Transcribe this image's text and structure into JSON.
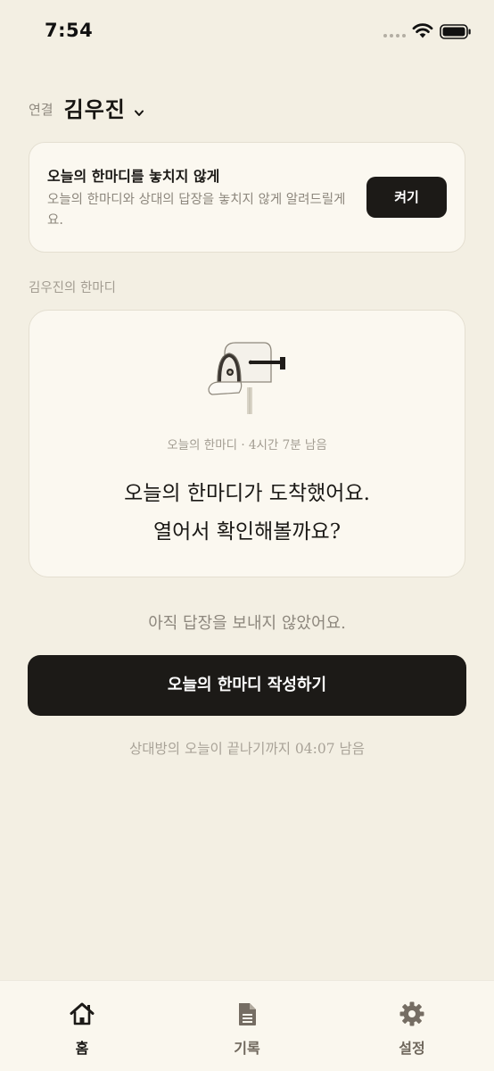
{
  "status_bar": {
    "time": "7:54"
  },
  "connection": {
    "label": "연결",
    "name": "김우진"
  },
  "notification_card": {
    "title": "오늘의 한마디를 놓치지 않게",
    "description": "오늘의 한마디와 상대의 답장을 놓치지 않게 알려드릴게요.",
    "button_label": "켜기"
  },
  "section_label": "김우진의 한마디",
  "message_card": {
    "meta": "오늘의 한마디 · 4시간 7분 남음",
    "line1": "오늘의 한마디가 도착했어요.",
    "line2": "열어서 확인해볼까요?"
  },
  "reply_status": "아직 답장을 보내지 않았어요.",
  "write_button_label": "오늘의 한마디 작성하기",
  "countdown_text": "상대방의 오늘이 끝나기까지 04:07 남음",
  "tabs": [
    {
      "label": "홈",
      "icon": "home-icon",
      "active": true
    },
    {
      "label": "기록",
      "icon": "document-icon",
      "active": false
    },
    {
      "label": "설정",
      "icon": "gear-icon",
      "active": false
    }
  ],
  "colors": {
    "background": "#f3efe3",
    "card": "#fbf8f0",
    "primary_button": "#1c1a17",
    "muted_text": "#8d877d"
  }
}
